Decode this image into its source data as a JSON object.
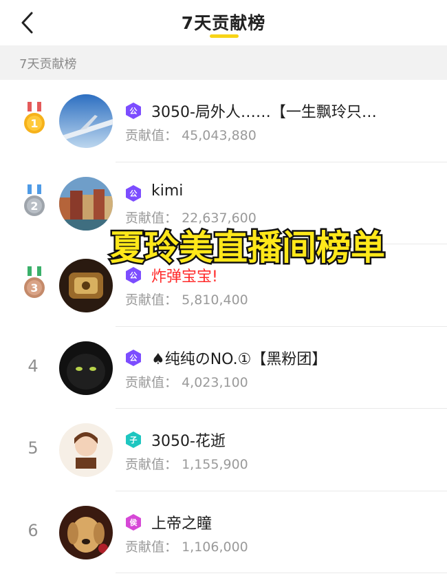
{
  "header": {
    "title": "7天贡献榜",
    "back_icon": "chevron-left-icon",
    "accent_color": "#f7d417"
  },
  "section": {
    "label": "7天贡献榜"
  },
  "contribution_label": "贡献值：",
  "ranking": [
    {
      "rank": "1",
      "medal": "gold",
      "badge": "公",
      "badge_color": "#7c4dff",
      "name": "3050-局外人……【一生飘玲只…",
      "value": "45,043,880",
      "name_color": "default"
    },
    {
      "rank": "2",
      "medal": "silver",
      "badge": "公",
      "badge_color": "#7c4dff",
      "name": "kimi",
      "value": "22,637,600",
      "name_color": "default"
    },
    {
      "rank": "3",
      "medal": "bronze",
      "badge": "公",
      "badge_color": "#7c4dff",
      "name": "炸弹宝宝!",
      "value": "5,810,400",
      "name_color": "red"
    },
    {
      "rank": "4",
      "medal": "",
      "badge": "公",
      "badge_color": "#7c4dff",
      "name": "♠纯纯のNO.①【黑粉团】",
      "value": "4,023,100",
      "name_color": "default"
    },
    {
      "rank": "5",
      "medal": "",
      "badge": "子",
      "badge_color": "#1ec6c0",
      "name": "3050-花逝",
      "value": "1,155,900",
      "name_color": "default"
    },
    {
      "rank": "6",
      "medal": "",
      "badge": "侯",
      "badge_color": "#d648d6",
      "name": "上帝之瞳",
      "value": "1,106,000",
      "name_color": "default"
    }
  ],
  "overlay_caption": "夏玲美直播间榜单"
}
